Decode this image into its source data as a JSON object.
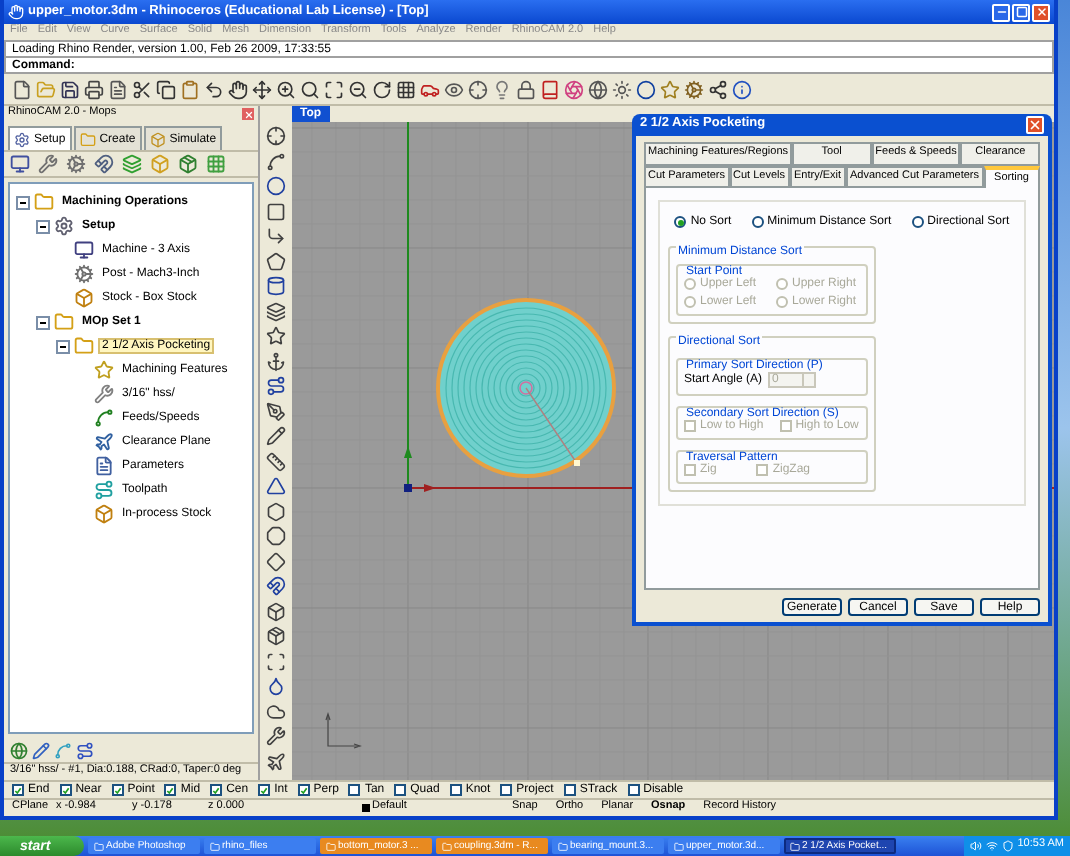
{
  "window": {
    "title": "upper_motor.3dm - Rhinoceros (Educational Lab License) - [Top]"
  },
  "menu": [
    "File",
    "Edit",
    "View",
    "Curve",
    "Surface",
    "Solid",
    "Mesh",
    "Dimension",
    "Transform",
    "Tools",
    "Analyze",
    "Render",
    "RhinoCAM 2.0",
    "Help"
  ],
  "command_history": "Loading Rhino Render, version 1.00, Feb 26 2009, 17:33:55",
  "command_prompt": "Command:",
  "mops_panel": {
    "title": "RhinoCAM 2.0 - Mops",
    "tabs": [
      {
        "label": "Setup",
        "selected": true
      },
      {
        "label": "Create",
        "selected": false
      },
      {
        "label": "Simulate",
        "selected": false
      }
    ],
    "tree": [
      {
        "label": "Machining Operations",
        "kind": "group",
        "expanded": true,
        "selected": false,
        "children": [
          {
            "label": "Setup",
            "kind": "setup",
            "expanded": true,
            "selected": false,
            "children": [
              {
                "label": "Machine - 3 Axis",
                "kind": "machine",
                "selected": false
              },
              {
                "label": "Post - Mach3-Inch",
                "kind": "post",
                "selected": false
              },
              {
                "label": "Stock - Box Stock",
                "kind": "stock",
                "selected": false
              }
            ]
          },
          {
            "label": "MOp Set 1",
            "kind": "group",
            "expanded": true,
            "selected": false,
            "children": [
              {
                "label": "2 1/2 Axis Pocketing",
                "kind": "operation",
                "expanded": true,
                "selected": true,
                "children": [
                  {
                    "label": "Machining Features",
                    "kind": "features",
                    "selected": false
                  },
                  {
                    "label": "3/16\" hss/",
                    "kind": "tool",
                    "selected": false
                  },
                  {
                    "label": "Feeds/Speeds",
                    "kind": "feeds",
                    "selected": false
                  },
                  {
                    "label": "Clearance Plane",
                    "kind": "clearance",
                    "selected": false
                  },
                  {
                    "label": "Parameters",
                    "kind": "parameters",
                    "selected": false
                  },
                  {
                    "label": "Toolpath",
                    "kind": "toolpath",
                    "selected": false
                  },
                  {
                    "label": "In-process Stock",
                    "kind": "stock",
                    "selected": false
                  }
                ]
              }
            ]
          }
        ]
      }
    ],
    "info": "3/16\" hss/ - #1, Dia:0.188, CRad:0, Taper:0 deg"
  },
  "viewport": {
    "label": "Top"
  },
  "dialog": {
    "title": "2 1/2 Axis Pocketing",
    "tabs_row_1": [
      {
        "label": "Machining Features/Regions",
        "selected": false
      },
      {
        "label": "Tool",
        "selected": false
      },
      {
        "label": "Feeds & Speeds",
        "selected": false
      },
      {
        "label": "Clearance",
        "selected": false
      }
    ],
    "tabs_row_2": [
      {
        "label": "Cut Parameters",
        "selected": false
      },
      {
        "label": "Cut Levels",
        "selected": false
      },
      {
        "label": "Entry/Exit",
        "selected": false
      },
      {
        "label": "Advanced Cut Parameters",
        "selected": false
      },
      {
        "label": "Sorting",
        "selected": true
      }
    ],
    "sort_options": [
      {
        "label": "No Sort",
        "selected": true
      },
      {
        "label": "Minimum Distance Sort",
        "selected": false
      },
      {
        "label": "Directional Sort",
        "selected": false
      }
    ],
    "min_distance": {
      "title": "Minimum Distance Sort",
      "start_point": {
        "title": "Start Point",
        "disabled": true,
        "options": [
          {
            "label": "Upper Left",
            "selected": false
          },
          {
            "label": "Upper Right",
            "selected": false
          },
          {
            "label": "Lower Left",
            "selected": false
          },
          {
            "label": "Lower Right",
            "selected": false
          }
        ]
      }
    },
    "directional": {
      "title": "Directional Sort",
      "primary": {
        "title": "Primary Sort Direction (P)",
        "disabled": true,
        "angle_label": "Start Angle (A)",
        "angle_value": "0"
      },
      "secondary": {
        "title": "Secondary Sort Direction (S)",
        "disabled": true,
        "options": [
          {
            "label": "Low to High",
            "checked": false
          },
          {
            "label": "High to Low",
            "checked": false
          }
        ]
      },
      "traversal": {
        "title": "Traversal Pattern",
        "disabled": true,
        "options": [
          {
            "label": "Zig",
            "checked": false
          },
          {
            "label": "ZigZag",
            "checked": false
          }
        ]
      }
    },
    "buttons": [
      "Generate",
      "Cancel",
      "Save",
      "Help"
    ]
  },
  "osnap": [
    {
      "label": "End",
      "checked": true
    },
    {
      "label": "Near",
      "checked": true
    },
    {
      "label": "Point",
      "checked": true
    },
    {
      "label": "Mid",
      "checked": true
    },
    {
      "label": "Cen",
      "checked": true
    },
    {
      "label": "Int",
      "checked": true
    },
    {
      "label": "Perp",
      "checked": true
    },
    {
      "label": "Tan",
      "checked": false
    },
    {
      "label": "Quad",
      "checked": false
    },
    {
      "label": "Knot",
      "checked": false
    },
    {
      "label": "Project",
      "checked": false
    },
    {
      "label": "STrack",
      "checked": false
    },
    {
      "label": "Disable",
      "checked": false
    }
  ],
  "status": {
    "cplane": "CPlane",
    "x": "x -0.984",
    "y": "y -0.178",
    "z": "z 0.000",
    "layer": "Default",
    "toggles": [
      {
        "label": "Snap",
        "on": false
      },
      {
        "label": "Ortho",
        "on": false
      },
      {
        "label": "Planar",
        "on": false
      },
      {
        "label": "Osnap",
        "on": true
      },
      {
        "label": "Record History",
        "on": false
      }
    ]
  },
  "taskbar": {
    "start": "start",
    "items": [
      {
        "label": "Adobe Photoshop",
        "selected": false,
        "flashing": false
      },
      {
        "label": "rhino_files",
        "selected": false,
        "flashing": false
      },
      {
        "label": "bottom_motor.3 ...",
        "selected": false,
        "flashing": true
      },
      {
        "label": "coupling.3dm - R...",
        "selected": false,
        "flashing": true
      },
      {
        "label": "bearing_mount.3...",
        "selected": false,
        "flashing": false
      },
      {
        "label": "upper_motor.3d...",
        "selected": false,
        "flashing": false
      },
      {
        "label": "2 1/2 Axis Pocket...",
        "selected": true,
        "flashing": false
      }
    ],
    "time": "10:53 AM"
  }
}
